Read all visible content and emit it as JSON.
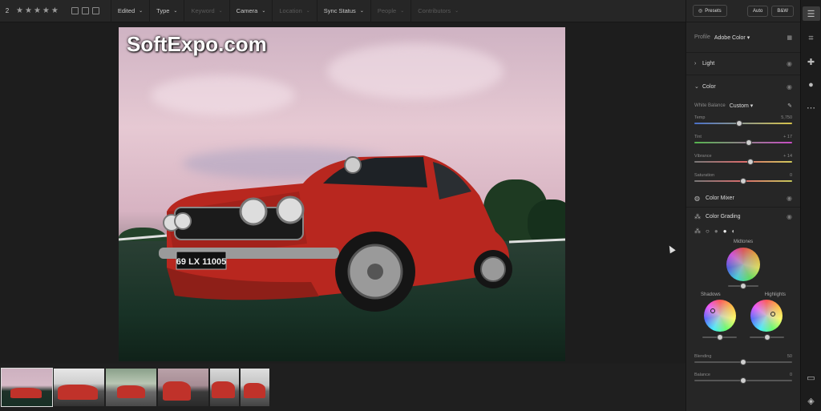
{
  "toolbar": {
    "count": "2",
    "stars": [
      "★",
      "★",
      "★",
      "★",
      "★"
    ],
    "filters": [
      {
        "label": "Edited",
        "dim": false
      },
      {
        "label": "Type",
        "dim": false
      },
      {
        "label": "Keyword",
        "dim": true
      },
      {
        "label": "Camera",
        "dim": false
      },
      {
        "label": "Location",
        "dim": true
      },
      {
        "label": "Sync Status",
        "dim": false
      },
      {
        "label": "People",
        "dim": true
      },
      {
        "label": "Contributors",
        "dim": true
      }
    ]
  },
  "photo": {
    "watermark": "SoftExpo.com",
    "plate": "69 LX 11005"
  },
  "panel": {
    "presets_label": "Presets",
    "auto_label": "Auto",
    "bw_label": "B&W",
    "profile_label": "Profile",
    "profile_value": "Adobe Color",
    "light_label": "Light",
    "color_label": "Color",
    "white_balance_label": "White Balance",
    "white_balance_value": "Custom",
    "temp_label": "Temp",
    "temp_value": "5,750",
    "temp_pos": 0.46,
    "tint_label": "Tint",
    "tint_value": "+ 17",
    "tint_pos": 0.56,
    "vibrance_label": "Vibrance",
    "vibrance_value": "+ 14",
    "vibrance_pos": 0.57,
    "saturation_label": "Saturation",
    "saturation_value": "0",
    "saturation_pos": 0.5,
    "color_mixer_label": "Color Mixer",
    "color_grading_label": "Color Grading",
    "midtones_label": "Midtones",
    "shadows_label": "Shadows",
    "highlights_label": "Highlights",
    "blending_label": "Blending",
    "blending_value": "50",
    "blending_pos": 0.5,
    "balance_label": "Balance",
    "balance_value": "0",
    "balance_pos": 0.5
  },
  "colors": {
    "accent_car": "#c0322a",
    "panel_bg": "#262626"
  },
  "icons": {
    "tools": [
      "sliders-icon",
      "crop-icon",
      "healing-icon",
      "mask-icon",
      "more-icon",
      "comment-icon",
      "tag-icon"
    ]
  }
}
